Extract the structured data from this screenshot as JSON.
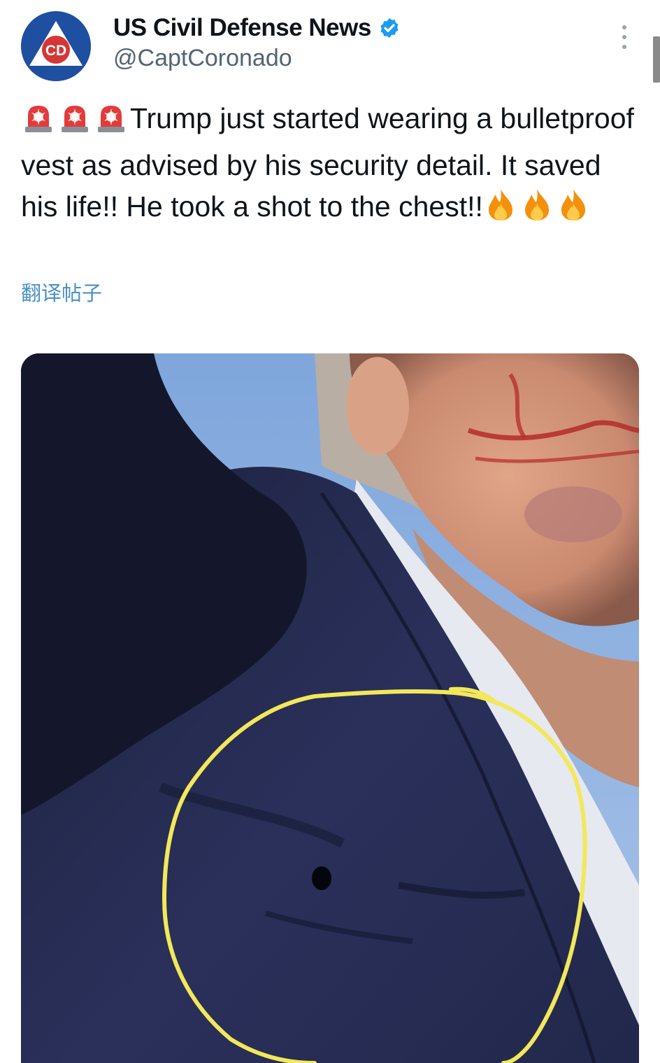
{
  "account": {
    "display_name": "US Civil Defense News",
    "handle": "@CaptCoronado",
    "avatar_text": "CD",
    "verified_icon": "verified-badge-icon"
  },
  "tweet": {
    "text": "Trump just started wearing a bulletproof vest as advised by his security detail. It saved his life!! He took a shot to the chest!!",
    "leading_emoji": [
      "🚨",
      "🚨",
      "🚨"
    ],
    "trailing_emoji": [
      "🔥",
      "🔥",
      "🔥"
    ],
    "translate_label": "翻译帖子"
  },
  "media": {
    "description": "photo",
    "annotation_color": "#f2e85a"
  },
  "colors": {
    "text": "#0f1419",
    "secondary": "#536471",
    "link": "#4a90c2",
    "verified": "#1d9bf0"
  }
}
